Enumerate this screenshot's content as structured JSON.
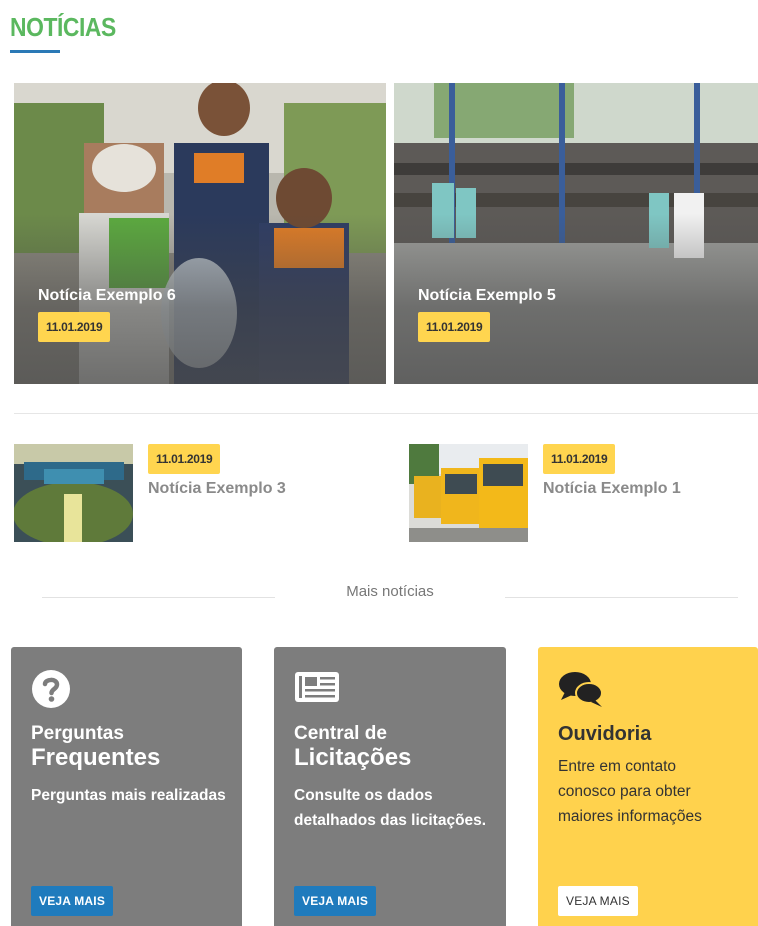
{
  "section": {
    "title": "NOTÍCIAS"
  },
  "featured": [
    {
      "title": "Notícia Exemplo 6",
      "date": "11.01.2019"
    },
    {
      "title": "Notícia Exemplo 5",
      "date": "11.01.2019"
    }
  ],
  "secondary": [
    {
      "title": "Notícia Exemplo 3",
      "date": "11.01.2019"
    },
    {
      "title": "Notícia Exemplo 1",
      "date": "11.01.2019"
    }
  ],
  "more_news": {
    "label": "Mais notícias"
  },
  "cards": [
    {
      "line1": "Perguntas",
      "line2": "Frequentes",
      "description": "Perguntas mais realizadas",
      "button": "VEJA MAIS",
      "icon": "question-circle-icon"
    },
    {
      "line1": "Central de",
      "line2": "Licitações",
      "description": "Consulte os dados detalhados das licitações.",
      "button": "VEJA MAIS",
      "icon": "newspaper-icon"
    },
    {
      "title": "Ouvidoria",
      "description": "Entre em contato conosco para obter maiores informações",
      "button": "VEJA MAIS",
      "icon": "comments-icon"
    }
  ],
  "colors": {
    "accent_green": "#5bb85f",
    "accent_blue": "#1f7bbd",
    "badge_yellow": "#ffd54f",
    "card_gray": "#7d7d7d",
    "card_yellow": "#ffd24d"
  }
}
